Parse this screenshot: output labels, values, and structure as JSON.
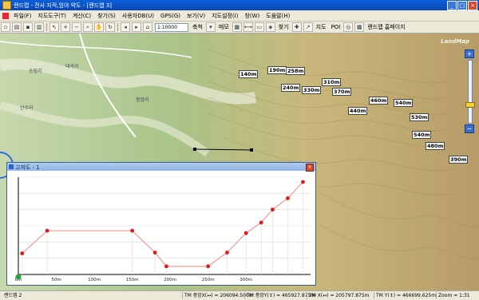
{
  "window": {
    "title": "랜드맵 - 전사 지적,임야 약도 - [랜드맵 3]",
    "minimize": "_",
    "maximize": "□",
    "close": "×"
  },
  "menu": [
    "파일(F)",
    "지도도구(T)",
    "계산(C)",
    "찾기(S)",
    "사용자DB(U)",
    "GPS(G)",
    "보기(V)",
    "지도설정(I)",
    "창(W)",
    "도움말(H)"
  ],
  "toolbar": {
    "scale_value": "1:10000",
    "scale_label": "축척",
    "memo_label": "메모",
    "find_label": "찾기",
    "map_label": "지도",
    "poi_label": "POI",
    "homepage_label": "랜드맵 홈페이지"
  },
  "map": {
    "watermark": "LandMap",
    "zoom_level_fraction": 0.72,
    "altitude_labels": [
      "140m",
      "190m",
      "258m",
      "240m",
      "310m",
      "330m",
      "370m",
      "440m",
      "460m",
      "540m",
      "530m",
      "540m",
      "480m",
      "390m"
    ],
    "place_labels": [
      "대곡리",
      "송림리",
      "봉암리",
      "산수리"
    ]
  },
  "profile": {
    "title": "고저도 - 1",
    "close": "×"
  },
  "chart_data": {
    "type": "line",
    "x": [
      0,
      50,
      100,
      150,
      200,
      250,
      300
    ],
    "xticks": [
      "0m",
      "50m",
      "100m",
      "150m",
      "200m",
      "250m",
      "300m"
    ],
    "ylim": [
      0,
      120
    ],
    "points": [
      {
        "x": 5,
        "y": 26
      },
      {
        "x": 38,
        "y": 54
      },
      {
        "x": 150,
        "y": 54
      },
      {
        "x": 180,
        "y": 27
      },
      {
        "x": 195,
        "y": 10
      },
      {
        "x": 250,
        "y": 10
      },
      {
        "x": 275,
        "y": 27
      },
      {
        "x": 300,
        "y": 51
      },
      {
        "x": 320,
        "y": 64
      },
      {
        "x": 335,
        "y": 80
      },
      {
        "x": 355,
        "y": 94
      },
      {
        "x": 375,
        "y": 114
      }
    ],
    "line_color": "#ff8080",
    "point_color": "#e01818"
  },
  "status": {
    "left": "랜드맵 2",
    "tm_x1": "TM 중앙X(↔) = 206094.500m",
    "tm_y1": "TM 중앙Y(↕) = 465927.875m",
    "tm_x2": "TM X(↔) = 205797.875m",
    "tm_y2": "TM Y(↕) = 466699.625m",
    "zoom": "Zoom = 1:31"
  }
}
